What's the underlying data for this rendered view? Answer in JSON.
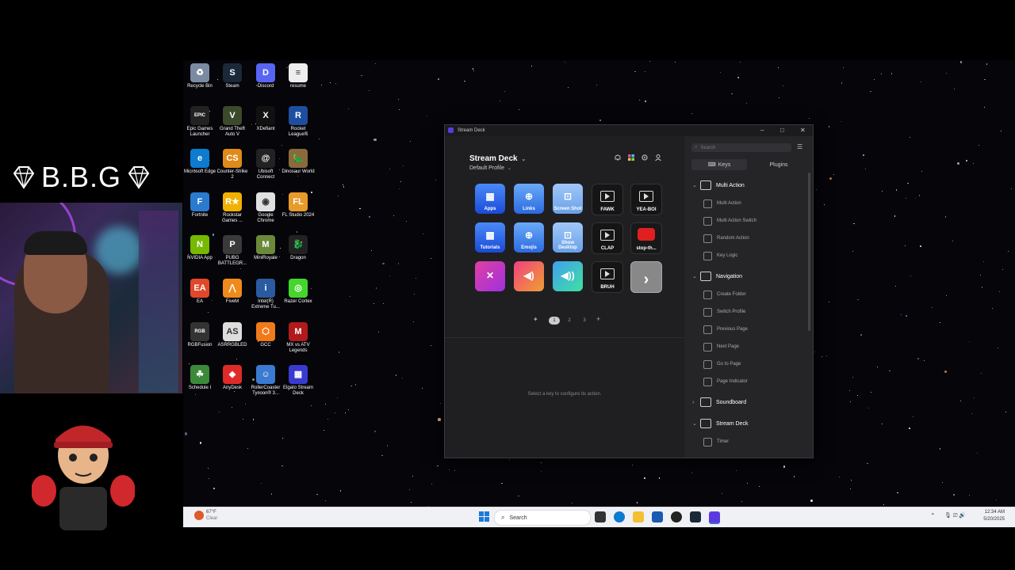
{
  "overlay": {
    "brand_text": "B.B.G"
  },
  "desktop_icons": [
    {
      "label": "Recycle Bin",
      "color": "#7a8aa0",
      "glyph": "♻"
    },
    {
      "label": "Steam",
      "color": "#1b2838",
      "glyph": "S"
    },
    {
      "label": "Discord",
      "color": "#5865f2",
      "glyph": "D"
    },
    {
      "label": "resume",
      "color": "#eeeeee",
      "glyph": "≡"
    },
    {
      "label": "Epic Games Launcher",
      "color": "#222",
      "glyph": "EPIC"
    },
    {
      "label": "Grand Theft Auto V",
      "color": "#3a4a2a",
      "glyph": "V"
    },
    {
      "label": "XDefiant",
      "color": "#111",
      "glyph": "X"
    },
    {
      "label": "Rocket League®",
      "color": "#1d4ea0",
      "glyph": "R"
    },
    {
      "label": "Microsoft Edge",
      "color": "#0c7bd0",
      "glyph": "e"
    },
    {
      "label": "Counter-Strike 2",
      "color": "#e08a1a",
      "glyph": "CS"
    },
    {
      "label": "Ubisoft Connect",
      "color": "#222",
      "glyph": "@"
    },
    {
      "label": "Dinosaur World",
      "color": "#8a6a3a",
      "glyph": "🦕"
    },
    {
      "label": "Fortnite",
      "color": "#2a7ad0",
      "glyph": "F"
    },
    {
      "label": "Rockstar Games ...",
      "color": "#f2b000",
      "glyph": "R★"
    },
    {
      "label": "Google Chrome",
      "color": "#e0e0e0",
      "glyph": "◉"
    },
    {
      "label": "FL Studio 2024",
      "color": "#e89a2a",
      "glyph": "FL"
    },
    {
      "label": "NVIDIA App",
      "color": "#76b900",
      "glyph": "N"
    },
    {
      "label": "PUBG BATTLEGR...",
      "color": "#3a3a3a",
      "glyph": "P"
    },
    {
      "label": "MiniRoyale",
      "color": "#6a8a3a",
      "glyph": "M"
    },
    {
      "label": "Dragon",
      "color": "#222",
      "glyph": "🐉"
    },
    {
      "label": "EA",
      "color": "#e0482a",
      "glyph": "EA"
    },
    {
      "label": "FiveM",
      "color": "#f08a1a",
      "glyph": "⋀"
    },
    {
      "label": "Intel(R) Extreme Tu...",
      "color": "#2a5aa0",
      "glyph": "i"
    },
    {
      "label": "Razer Cortex",
      "color": "#44d62c",
      "glyph": "◎"
    },
    {
      "label": "RGBFusion",
      "color": "#333",
      "glyph": "RGB"
    },
    {
      "label": "ASRRGBLED",
      "color": "#ddd",
      "glyph": "AS"
    },
    {
      "label": "GCC",
      "color": "#f07a1a",
      "glyph": "⬡"
    },
    {
      "label": "MX vs ATV Legends",
      "color": "#b01a1a",
      "glyph": "M"
    },
    {
      "label": "Schedule I",
      "color": "#3a8a3a",
      "glyph": "☘"
    },
    {
      "label": "AnyDesk",
      "color": "#e02a2a",
      "glyph": "◆"
    },
    {
      "label": "RollerCoaster Tycoon® 3...",
      "color": "#3a7ad0",
      "glyph": "☺"
    },
    {
      "label": "Elgato Stream Deck",
      "color": "#3a3ad0",
      "glyph": "▦"
    }
  ],
  "app": {
    "title": "Stream Deck",
    "device_name": "Stream Deck",
    "profile": "Default Profile",
    "chevron": "⌄",
    "pages": [
      "1",
      "2",
      "3"
    ],
    "empty_hint": "Select a key to configure its action.",
    "keys": [
      {
        "label": "Apps",
        "style": "blue"
      },
      {
        "label": "Links",
        "style": "blue2"
      },
      {
        "label": "Screen Shot",
        "style": "light"
      },
      {
        "label": "FAWK",
        "style": "dark"
      },
      {
        "label": "YEA-BOI",
        "style": "dark"
      },
      {
        "label": "Tutorials",
        "style": "blue"
      },
      {
        "label": "Emojis",
        "style": "blue2"
      },
      {
        "label": "Show Desktop",
        "style": "light"
      },
      {
        "label": "CLAP",
        "style": "dark"
      },
      {
        "label": "stop-th...",
        "style": "red"
      },
      {
        "label": "",
        "style": "mute"
      },
      {
        "label": "",
        "style": "vol"
      },
      {
        "label": "",
        "style": "vol2"
      },
      {
        "label": "BRUH",
        "style": "dark"
      },
      {
        "label": "",
        "style": "next"
      }
    ]
  },
  "panel": {
    "search_placeholder": "Search",
    "tab_keys": "Keys",
    "tab_plugins": "Plugins",
    "sections": [
      {
        "title": "Multi Action",
        "expanded": true,
        "items": [
          "Multi Action",
          "Multi Action Switch",
          "Random Action",
          "Key Logic"
        ]
      },
      {
        "title": "Navigation",
        "expanded": true,
        "items": [
          "Create Folder",
          "Switch Profile",
          "Previous Page",
          "Next Page",
          "Go to Page",
          "Page Indicator"
        ]
      },
      {
        "title": "Soundboard",
        "expanded": false,
        "items": []
      },
      {
        "title": "Stream Deck",
        "expanded": true,
        "items": [
          "Timer"
        ]
      }
    ]
  },
  "taskbar": {
    "weather_temp": "67°F",
    "weather_desc": "Clear",
    "search_label": "Search",
    "time": "12:34 AM",
    "date": "5/20/2025"
  }
}
